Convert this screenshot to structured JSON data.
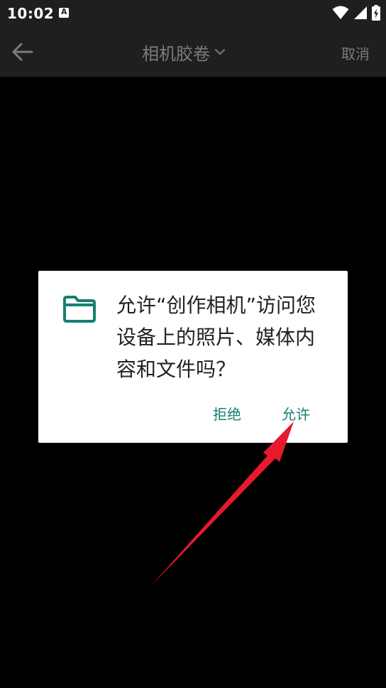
{
  "status_bar": {
    "time": "10:02",
    "notification_icon": "A",
    "icons": [
      "wifi-icon",
      "signal-icon",
      "battery-charging-icon"
    ]
  },
  "app_bar": {
    "back_icon": "arrow-left-icon",
    "title": "相机胶卷",
    "dropdown_icon": "chevron-down-icon",
    "cancel_label": "取消"
  },
  "dialog": {
    "icon": "folder-icon",
    "message": "允许“创作相机”访问您设备上的照片、媒体内容和文件吗？",
    "deny_label": "拒绝",
    "allow_label": "允许"
  },
  "annotation": {
    "type": "arrow",
    "color": "#e8192c",
    "points_to": "allow-button"
  },
  "colors": {
    "background": "#000000",
    "bar": "#1f1f1f",
    "accent": "#16806f",
    "muted_text": "#7b7b7b"
  }
}
